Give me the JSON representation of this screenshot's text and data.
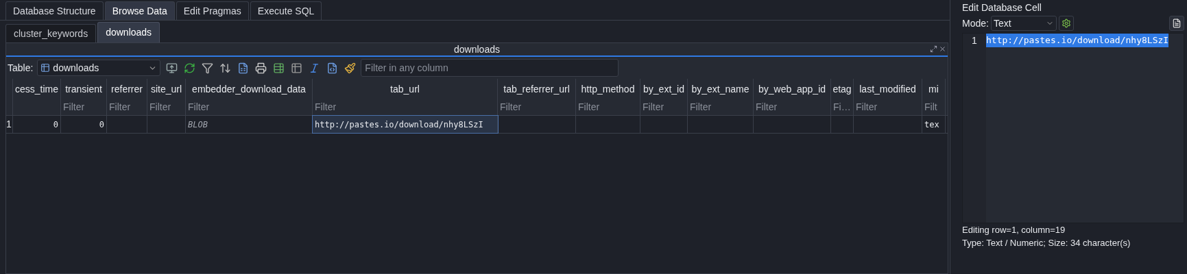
{
  "main_tabs": [
    {
      "label": "Database Structure",
      "selected": false
    },
    {
      "label": "Browse Data",
      "selected": true
    },
    {
      "label": "Edit Pragmas",
      "selected": false
    },
    {
      "label": "Execute SQL",
      "selected": false
    }
  ],
  "sub_tabs": [
    {
      "label": "cluster_keywords",
      "selected": false
    },
    {
      "label": "downloads",
      "selected": true
    }
  ],
  "dock": {
    "title": "downloads"
  },
  "toolbar": {
    "table_label": "Table:",
    "table_value": "downloads",
    "filter_placeholder": "Filter in any column"
  },
  "table": {
    "columns": [
      {
        "name": "cess_time"
      },
      {
        "name": "transient",
        "filter": "Filter"
      },
      {
        "name": "referrer",
        "filter": "Filter"
      },
      {
        "name": "site_url",
        "filter": "Filter"
      },
      {
        "name": "embedder_download_data",
        "filter": "Filter"
      },
      {
        "name": "tab_url",
        "filter": "Filter"
      },
      {
        "name": "tab_referrer_url",
        "filter": "Filter"
      },
      {
        "name": "http_method",
        "filter": "Filter"
      },
      {
        "name": "by_ext_id",
        "filter": "Filter"
      },
      {
        "name": "by_ext_name",
        "filter": "Filter"
      },
      {
        "name": "by_web_app_id",
        "filter": "Filter"
      },
      {
        "name": "etag",
        "filter": "Fi…"
      },
      {
        "name": "last_modified",
        "filter": "Filter"
      },
      {
        "name": "mi",
        "filter": "Filt"
      }
    ],
    "rows": [
      {
        "number": "1",
        "cells": [
          {
            "text": "0",
            "kind": "number",
            "selected": false
          },
          {
            "text": "0",
            "kind": "number",
            "selected": false
          },
          {
            "text": "",
            "kind": "text",
            "selected": false
          },
          {
            "text": "",
            "kind": "text",
            "selected": false
          },
          {
            "text": "BLOB",
            "kind": "blob",
            "selected": false
          },
          {
            "text": "http://pastes.io/download/nhy8LSzI",
            "kind": "text",
            "selected": true
          },
          {
            "text": "",
            "kind": "text",
            "selected": false
          },
          {
            "text": "",
            "kind": "text",
            "selected": false
          },
          {
            "text": "",
            "kind": "text",
            "selected": false
          },
          {
            "text": "",
            "kind": "text",
            "selected": false
          },
          {
            "text": "",
            "kind": "text",
            "selected": false
          },
          {
            "text": "",
            "kind": "text",
            "selected": false
          },
          {
            "text": "",
            "kind": "text",
            "selected": false
          },
          {
            "text": "tex",
            "kind": "text",
            "selected": false
          }
        ]
      }
    ]
  },
  "edit_cell": {
    "title": "Edit Database Cell",
    "mode_label": "Mode:",
    "mode_value": "Text",
    "lines": [
      {
        "number": "1",
        "text": "http://pastes.io/download/nhy8LSzI",
        "selected": true
      }
    ],
    "status": [
      "Editing row=1, column=19",
      "Type: Text / Numeric; Size: 34 character(s)"
    ]
  }
}
